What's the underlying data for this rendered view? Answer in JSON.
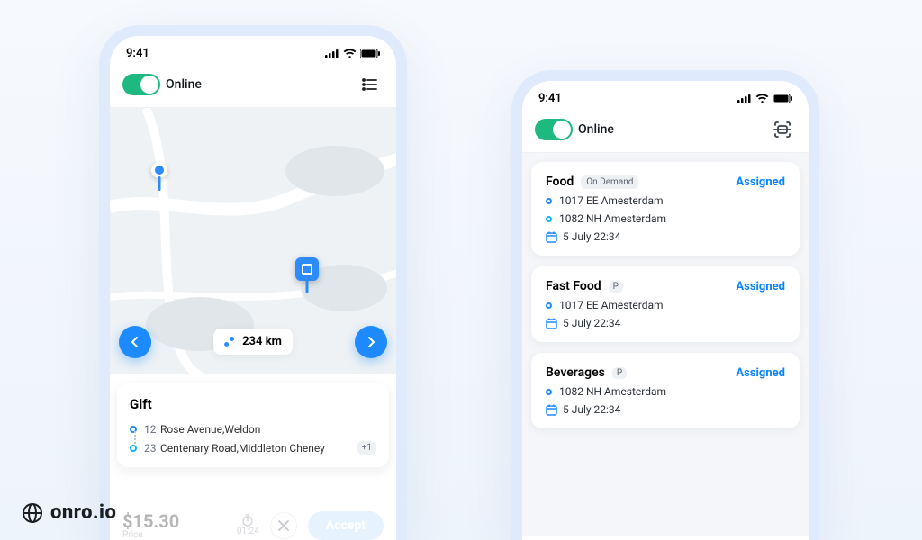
{
  "statusbar": {
    "time": "9:41"
  },
  "header": {
    "online_label": "Online"
  },
  "left": {
    "distance_label": "234 km",
    "order": {
      "title": "Gift",
      "stop1_num": "12",
      "stop1_addr": "Rose Avenue,Weldon",
      "stop2_num": "23",
      "stop2_addr": "Centenary Road,Middleton Cheney",
      "more_badge": "+1"
    },
    "bottom": {
      "price": "$15.30",
      "price_label": "Price",
      "timer": "01:24",
      "accept_label": "Accept"
    }
  },
  "right": {
    "cards": [
      {
        "title": "Food",
        "chip": "On Demand",
        "status": "Assigned",
        "stops": [
          "1017 EE Amesterdam",
          "1082 NH Amesterdam"
        ],
        "time": "5 July 22:34"
      },
      {
        "title": "Fast Food",
        "chip": "P",
        "status": "Assigned",
        "stops": [
          "1017 EE Amesterdam"
        ],
        "time": "5 July 22:34"
      },
      {
        "title": "Beverages",
        "chip": "P",
        "status": "Assigned",
        "stops": [
          "1082 NH Amesterdam"
        ],
        "time": "5 July 22:34"
      }
    ]
  },
  "brand": "onro.io"
}
